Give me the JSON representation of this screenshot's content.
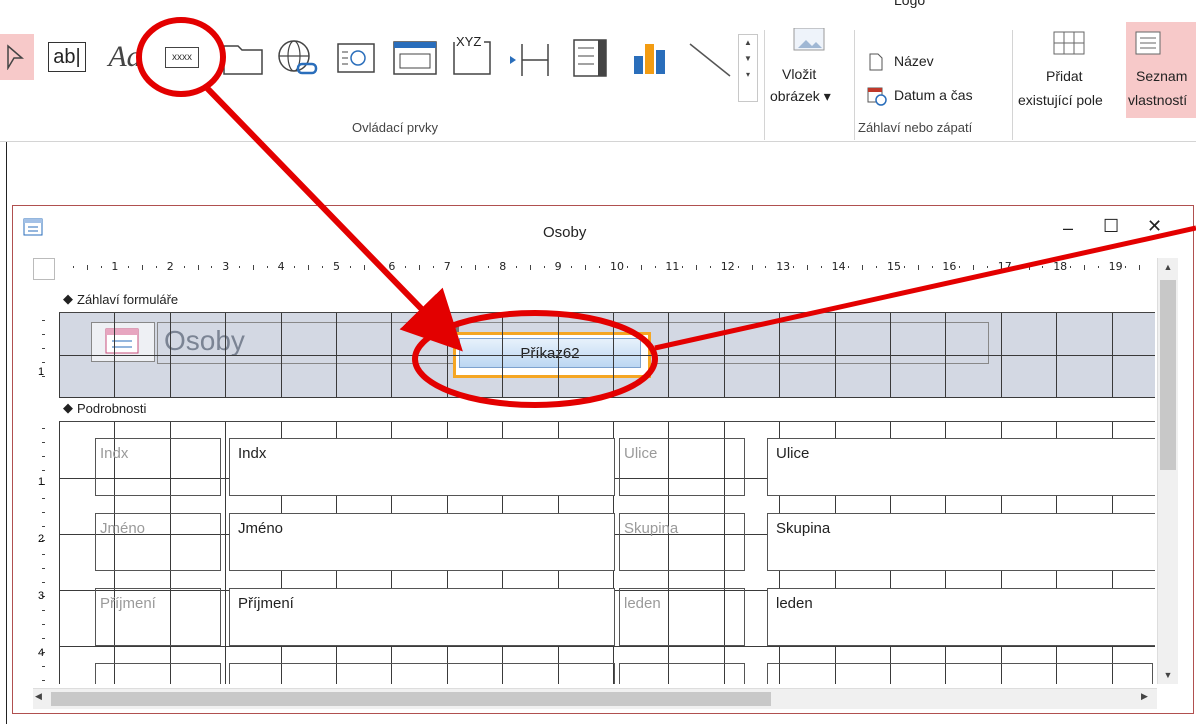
{
  "ribbon": {
    "controls_group_label": "Ovládací prvky",
    "header_group_label": "Záhlaví nebo zápatí",
    "text_ab": "ab|",
    "text_aa": "Aa",
    "text_xxxx": "xxxx",
    "text_xyz": "XYZ",
    "insert_image_line1": "Vložit",
    "insert_image_line2": "obrázek",
    "logo_label": "Logo",
    "title_label": "Název",
    "datetime_label": "Datum a čas",
    "add_field_line1": "Přidat",
    "add_field_line2": "existující pole",
    "props_line1": "Seznam",
    "props_line2": "vlastností"
  },
  "window": {
    "title": "Osoby",
    "minimize": "–",
    "maximize": "☐",
    "close": "✕"
  },
  "ruler": {
    "numbers": [
      "1",
      "2",
      "3",
      "4",
      "5",
      "6",
      "7",
      "8",
      "9",
      "10",
      "11",
      "12",
      "13",
      "14",
      "15",
      "16",
      "17",
      "18",
      "19"
    ]
  },
  "vruler": {
    "header_numbers": [
      "1"
    ],
    "detail_numbers": [
      "1",
      "2",
      "3",
      "4"
    ]
  },
  "sections": {
    "header": "Záhlaví formuláře",
    "detail": "Podrobnosti"
  },
  "header_form": {
    "title": "Osoby",
    "button": "Příkaz62"
  },
  "fields": [
    {
      "label": "Indx",
      "value": "Indx"
    },
    {
      "label": "Jméno",
      "value": "Jméno"
    },
    {
      "label": "Příjmení",
      "value": "Příjmení"
    },
    {
      "label": "Ulice",
      "value": "Ulice"
    },
    {
      "label": "Skupina",
      "value": "Skupina"
    },
    {
      "label": "leden",
      "value": "leden"
    }
  ],
  "colors": {
    "accent_red": "#e30000",
    "header_band": "#d3d8e3",
    "button_orange": "#f5a623",
    "button_fill": "#cfe3f7"
  }
}
